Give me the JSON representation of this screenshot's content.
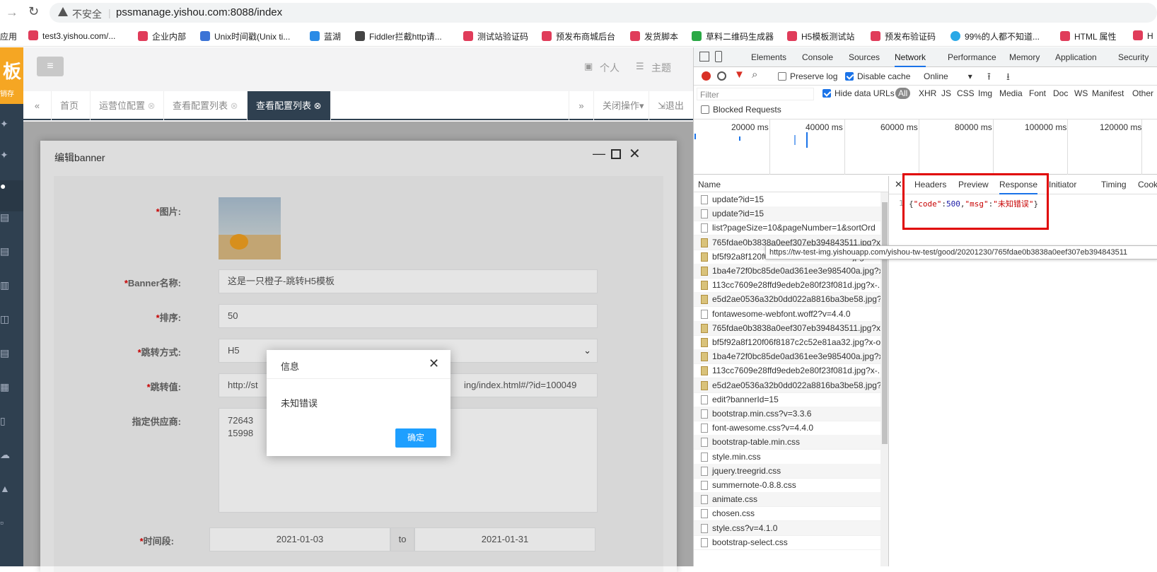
{
  "browser": {
    "insecure_label": "不安全",
    "url": "pssmanage.yishou.com:8088/index",
    "bookmarks": [
      "应用",
      "test3.yishou.com/...",
      "企业内部",
      "Unix时间戳(Unix ti...",
      "蓝湖",
      "Fiddler拦截http请...",
      "测试站验证码",
      "预发布商城后台",
      "发货脚本",
      "草料二维码生成器",
      "H5模板测试站",
      "预发布验证码",
      "99%的人都不知道...",
      "HTML 属性",
      "H"
    ]
  },
  "app": {
    "logo_text": "板",
    "logo_sub": "销存",
    "top_right": {
      "personal": "个人",
      "theme": "主题"
    },
    "tabs": [
      {
        "label": "首页"
      },
      {
        "label": "运营位配置"
      },
      {
        "label": "查看配置列表"
      },
      {
        "label": "查看配置列表"
      }
    ],
    "tab_actions": {
      "close_ops": "关闭操作",
      "logout": "退出"
    },
    "edit_window": {
      "title": "编辑banner",
      "fields": {
        "image_label": "图片:",
        "name_label": "Banner名称:",
        "name_value": "这是一只橙子-跳转H5模板",
        "sort_label": "排序:",
        "sort_value": "50",
        "jump_type_label": "跳转方式:",
        "jump_type_value": "H5",
        "jump_value_label": "跳转值:",
        "jump_value_start": "http://st",
        "jump_value_end": "ing/index.html#/?id=100049",
        "supplier_label": "指定供应商:",
        "supplier_values": [
          "72643",
          "15998"
        ],
        "period_label": "时间段:",
        "period_start": "2021-01-03",
        "period_to": "to",
        "period_end": "2021-01-31"
      }
    },
    "dialog": {
      "title": "信息",
      "message": "未知错误",
      "confirm": "确定"
    }
  },
  "devtools": {
    "tabs": [
      "Elements",
      "Console",
      "Sources",
      "Network",
      "Performance",
      "Memory",
      "Application",
      "Security"
    ],
    "active_tab": "Network",
    "toolbar": {
      "preserve_log": "Preserve log",
      "disable_cache": "Disable cache",
      "throttle": "Online"
    },
    "filter": {
      "placeholder": "Filter",
      "hide_data_urls": "Hide data URLs",
      "types": [
        "All",
        "XHR",
        "JS",
        "CSS",
        "Img",
        "Media",
        "Font",
        "Doc",
        "WS",
        "Manifest",
        "Other"
      ],
      "blocked_requests": "Blocked Requests"
    },
    "timeline_ticks": [
      "20000 ms",
      "40000 ms",
      "60000 ms",
      "80000 ms",
      "100000 ms",
      "120000 ms"
    ],
    "name_header": "Name",
    "requests": [
      {
        "name": "update?id=15",
        "type": "doc"
      },
      {
        "name": "update?id=15",
        "type": "doc"
      },
      {
        "name": "list?pageSize=10&pageNumber=1&sortOrd",
        "type": "doc"
      },
      {
        "name": "765fdae0b3838a0eef307eb394843511.jpg?x-",
        "type": "img"
      },
      {
        "name": "bf5f92a8f120f06f8187c2c52e81aa32.jpg?x-o",
        "type": "img"
      },
      {
        "name": "1ba4e72f0bc85de0ad361ee3e985400a.jpg?x",
        "type": "img"
      },
      {
        "name": "113cc7609e28ffd9edeb2e80f23f081d.jpg?x-.",
        "type": "img"
      },
      {
        "name": "e5d2ae0536a32b0dd022a8816ba3be58.jpg?",
        "type": "img"
      },
      {
        "name": "fontawesome-webfont.woff2?v=4.4.0",
        "type": "doc"
      },
      {
        "name": "765fdae0b3838a0eef307eb394843511.jpg?x-",
        "type": "img"
      },
      {
        "name": "bf5f92a8f120f06f8187c2c52e81aa32.jpg?x-o",
        "type": "img"
      },
      {
        "name": "1ba4e72f0bc85de0ad361ee3e985400a.jpg?x",
        "type": "img"
      },
      {
        "name": "113cc7609e28ffd9edeb2e80f23f081d.jpg?x-.",
        "type": "img"
      },
      {
        "name": "e5d2ae0536a32b0dd022a8816ba3be58.jpg?",
        "type": "img"
      },
      {
        "name": "edit?bannerId=15",
        "type": "doc"
      },
      {
        "name": "bootstrap.min.css?v=3.3.6",
        "type": "doc"
      },
      {
        "name": "font-awesome.css?v=4.4.0",
        "type": "doc"
      },
      {
        "name": "bootstrap-table.min.css",
        "type": "doc"
      },
      {
        "name": "style.min.css",
        "type": "doc"
      },
      {
        "name": "jquery.treegrid.css",
        "type": "doc"
      },
      {
        "name": "summernote-0.8.8.css",
        "type": "doc"
      },
      {
        "name": "animate.css",
        "type": "doc"
      },
      {
        "name": "chosen.css",
        "type": "doc"
      },
      {
        "name": "style.css?v=4.1.0",
        "type": "doc"
      },
      {
        "name": "bootstrap-select.css",
        "type": "doc"
      }
    ],
    "detail_tabs": [
      "Headers",
      "Preview",
      "Response",
      "Initiator",
      "Timing",
      "Cookie"
    ],
    "active_detail_tab": "Response",
    "response_line_no": "1",
    "response_json": {
      "open": "{",
      "k1": "\"code\"",
      "colon1": ":",
      "v1": "500",
      "comma": ",",
      "k2": "\"msg\"",
      "colon2": ":",
      "v2": "\"未知错误\"",
      "close": "}"
    },
    "tooltip_url": "https://tw-test-img.yishouapp.com/yishou-tw-test/good/20201230/765fdae0b3838a0eef307eb394843511"
  },
  "colors": {
    "accent": "#1a73e8",
    "sidebar": "#2f4050",
    "confirm_btn": "#1e9fff",
    "highlight_box": "#e00000"
  }
}
